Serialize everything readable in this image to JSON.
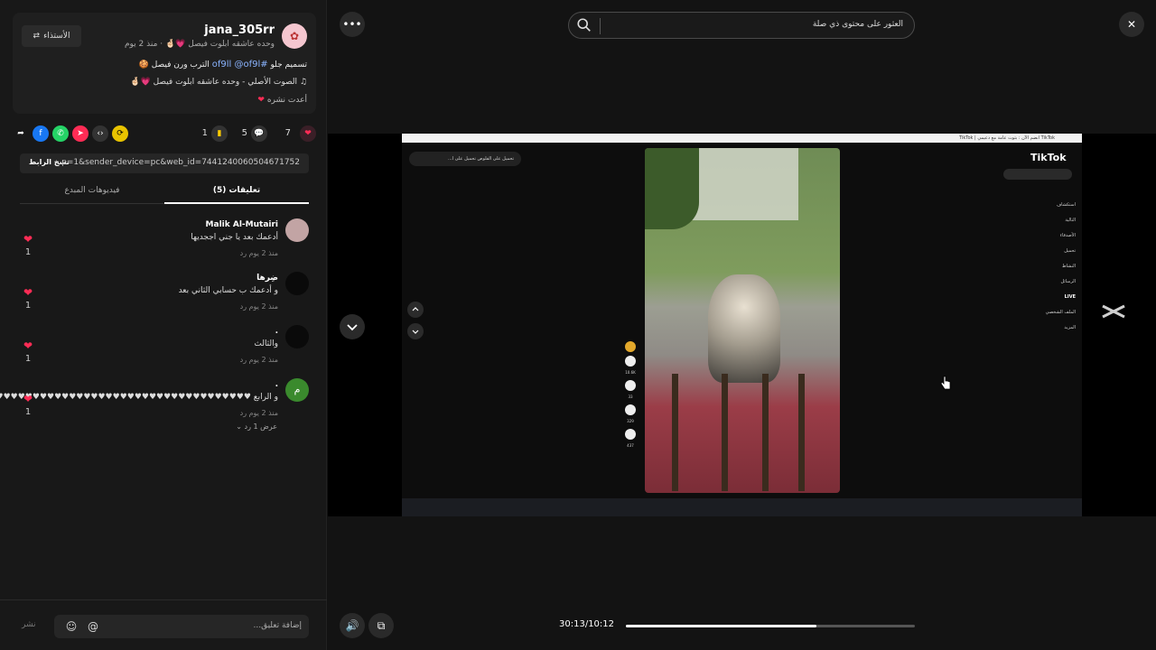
{
  "author": {
    "username": "jana_305rr",
    "nickname": "وحده عاشقه ابلوت فيصل 💗🤞🏻",
    "posted": "منذ 2 يوم",
    "stitch_label": "الأستذاء",
    "caption_prefix": "تسميم جلو",
    "caption_tags": "#of9ll @of9l",
    "caption_suffix": "الترب ورن فيصل 🍪",
    "sound": "الصوت الأصلي - وحده عاشقه ابلوت فيصل 💗🤞🏻",
    "reposted": "أعدت نشره"
  },
  "actions": {
    "likes": "7",
    "comments": "5",
    "saves": "1"
  },
  "share_link": {
    "copy_label": "نسخ الرابط",
    "url": "...p=1&sender_device=pc&web_id=7441240060504671752"
  },
  "tabs": {
    "comments": "تعليقات (5)",
    "creator_videos": "فيديوهات المبدع"
  },
  "comments": [
    {
      "name": "Malik Al-Mutairi",
      "text": "أدعمك بعد يا جني اججديها",
      "meta": "منذ 2 يوم    رد",
      "likes": "1",
      "avatar_color": "#c2a4a4"
    },
    {
      "name": "ضِرها",
      "text": "و أدعمك ب حسابي الثاني بعد",
      "meta": "منذ 2 يوم    رد",
      "likes": "1",
      "avatar_color": "#0a0a0a"
    },
    {
      "name": ".",
      "text": "والثالث",
      "meta": "منذ 2 يوم    رد",
      "likes": "1",
      "avatar_color": "#0a0a0a"
    },
    {
      "name": ".",
      "text": "و الرابع ♥♥♥♥♥♥♥♥♥♥♥♥♥♥♥♥♥♥♥♥♥♥♥♥♥♥♥♥♥♥♥♥♥♥♥♥♥♥♥♥",
      "meta": "منذ 2 يوم    رد",
      "likes": "1",
      "avatar_color": "#3a8a2d"
    }
  ],
  "view_replies": "عرض 1 رد ⌄",
  "comment_box": {
    "placeholder": "إضافة تعليق...",
    "post_label": "نشر"
  },
  "search": {
    "text": "العثور على محتوى ذي صلة"
  },
  "player": {
    "time": "30:13/10:12",
    "progress": 0.66
  },
  "inner_screen": {
    "pill_text": "تحميل على الفلوص    تحميل على ا...",
    "tab_text": "TikTok | انضم الآن : بثوث عامة مع دعيمي TikTok",
    "logo": "TikTok",
    "nav_items": [
      "",
      "استكشاف",
      "التالية",
      "الأصدقاء",
      "تحميل",
      "النشاط",
      "الرسائل",
      "LIVE",
      "الملف الشخصي",
      "المزيد"
    ],
    "counts": [
      "10.6K",
      "33",
      "329",
      "437"
    ]
  },
  "colors": {
    "accent": "#fe2c55",
    "background": "#121212"
  }
}
